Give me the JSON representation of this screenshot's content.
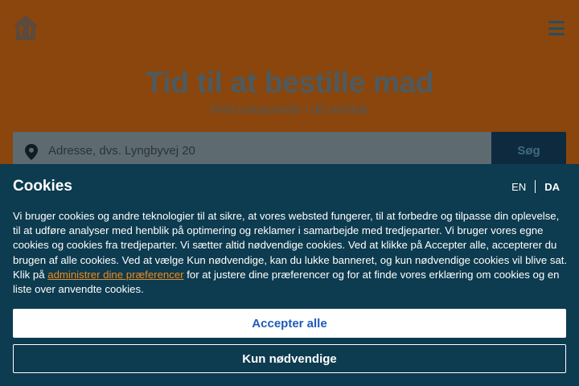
{
  "colors": {
    "page_bg_dimmed": "#8a460c",
    "banner_bg": "#0d3b4f",
    "link_orange": "#f08a1c",
    "accept_text_blue": "#1f5bb8",
    "search_button_bg": "#0e2a3e"
  },
  "header": {
    "logo_icon": "house-with-cutlery-icon",
    "menu_icon": "hamburger-menu-icon"
  },
  "hero": {
    "title": "Tid til at bestille mad",
    "subtitle": "Find restauranter i dit område"
  },
  "search": {
    "icon": "location-pin-icon",
    "placeholder": "Adresse, dvs. Lyngbyvej 20",
    "button_label": "Søg"
  },
  "cookies": {
    "title": "Cookies",
    "languages": [
      {
        "code": "EN",
        "active": false
      },
      {
        "code": "DA",
        "active": true
      }
    ],
    "text_before_link": "Vi bruger cookies og andre teknologier til at sikre, at vores websted fungerer, til at forbedre og tilpasse din oplevelse, til at udføre analyser med henblik på optimering og reklamer i samarbejde med tredjeparter. Vi bruger vores egne cookies og cookies fra tredjeparter. Vi sætter altid nødvendige cookies. Ved at klikke på Accepter alle, accepterer du brugen af alle cookies. Ved at vælge Kun nødvendige, kan du lukke banneret, og kun nødvendige cookies vil blive sat. Klik på ",
    "link_text": "administrer dine præferencer",
    "text_after_link": " for at justere dine præferencer og for at finde vores erklæring om cookies og en liste over anvendte cookies.",
    "accept_all_label": "Accepter alle",
    "necessary_only_label": "Kun nødvendige"
  }
}
